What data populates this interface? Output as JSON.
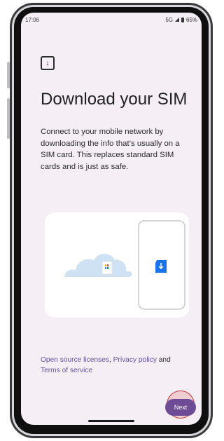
{
  "status_bar": {
    "time": "17:06",
    "network": "5G",
    "battery": "65%"
  },
  "setup": {
    "title": "Download your SIM",
    "description": "Connect to your mobile network by downloading the info that’s usually on a SIM card. This replaces standard SIM cards and is just as safe.",
    "legal": {
      "open_source": "Open source licenses",
      "comma": ", ",
      "privacy": "Privacy policy",
      "and": " and",
      "terms": "Terms of service"
    },
    "next_label": "Next"
  },
  "icons": {
    "header": "sim-download-icon",
    "illustration": "cloud-phone-sim-illustration"
  },
  "colors": {
    "accent": "#6750a4",
    "button": "#6e4b95",
    "background": "#f5eef5"
  }
}
